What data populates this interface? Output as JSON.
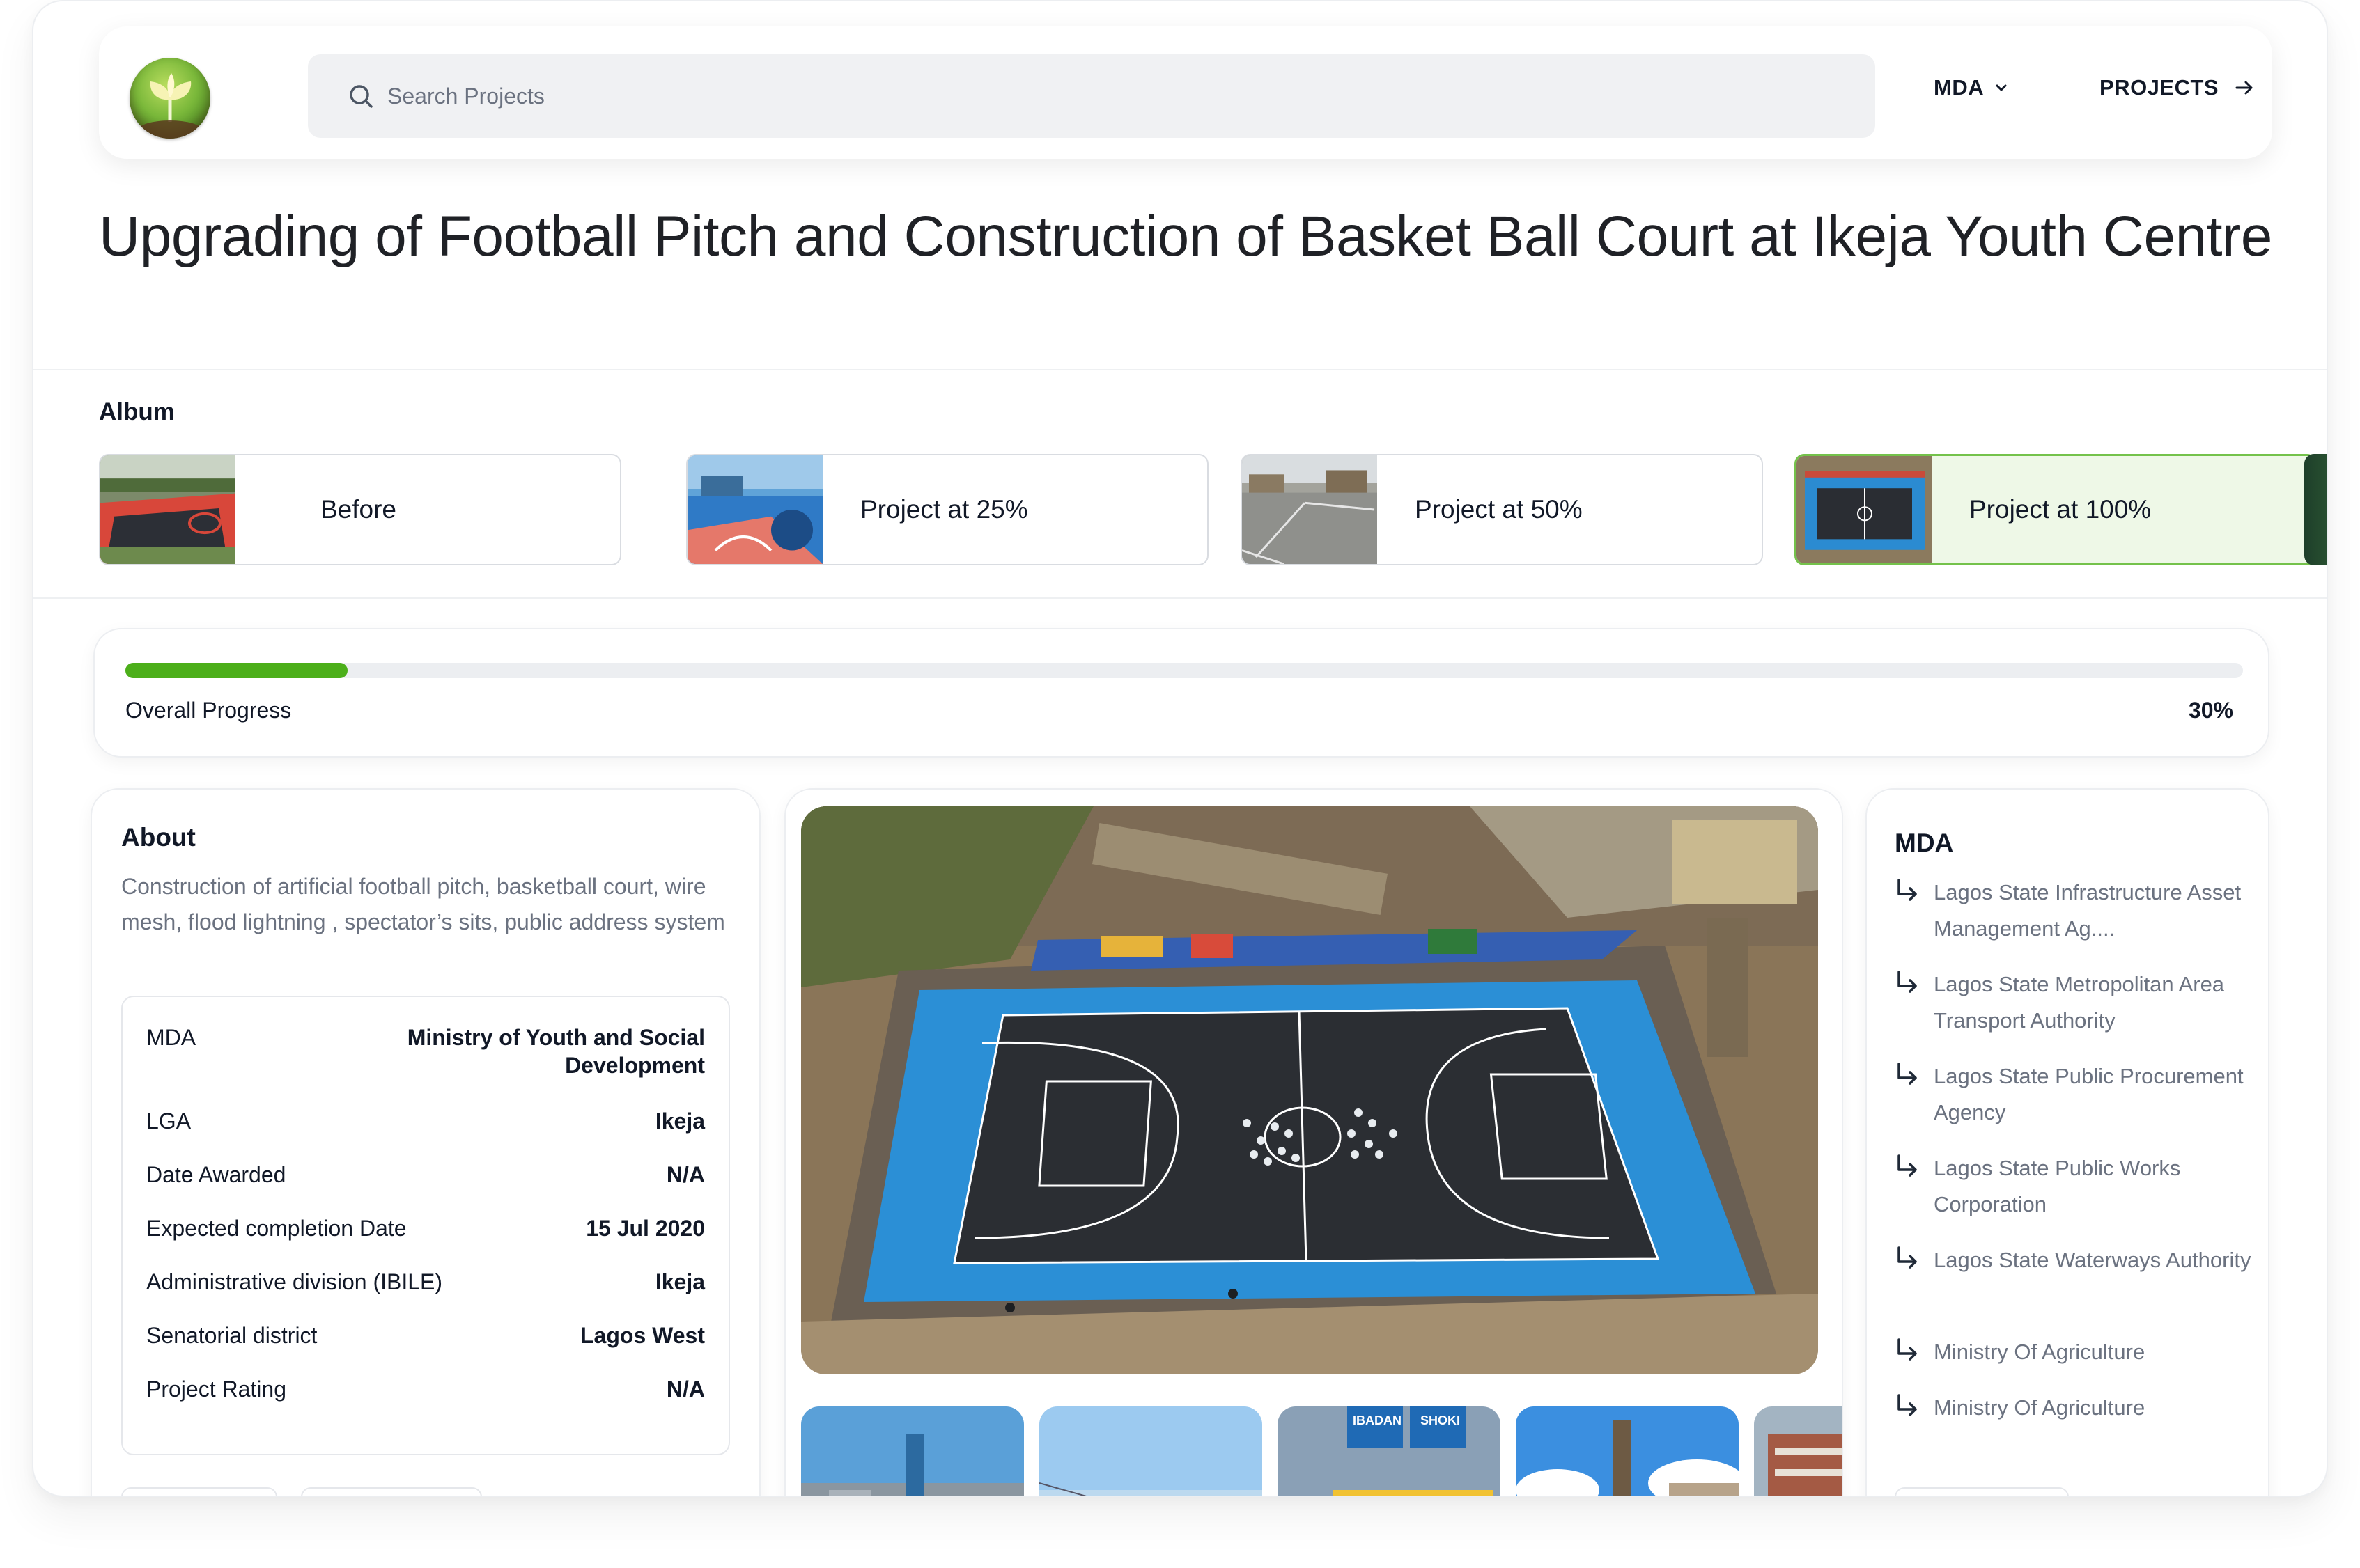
{
  "header": {
    "search_placeholder": "Search Projects",
    "nav_mda": "MDA",
    "nav_projects": "PROJECTS"
  },
  "project": {
    "title": "Upgrading of Football Pitch and Construction of  Basket Ball Court at Ikeja Youth Centre"
  },
  "album": {
    "label": "Album",
    "items": [
      {
        "label": "Before",
        "active": false
      },
      {
        "label": "Project at 25%",
        "active": false
      },
      {
        "label": "Project at 50%",
        "active": false
      },
      {
        "label": "Project at 100%",
        "active": true
      }
    ]
  },
  "progress": {
    "label": "Overall Progress",
    "value_text": "30%",
    "value": 0.105
  },
  "about": {
    "title": "About",
    "description": "Construction of artificial football pitch, basketball court, wire mesh, flood lightning , spectator’s sits, public address system",
    "details": [
      {
        "key": "MDA",
        "value": "Ministry of Youth and Social Development"
      },
      {
        "key": "LGA",
        "value": "Ikeja"
      },
      {
        "key": "Date Awarded",
        "value": "N/A"
      },
      {
        "key": "Expected completion Date",
        "value": "15 Jul 2020"
      },
      {
        "key": "Administrative division (IBILE)",
        "value": "Ikeja"
      },
      {
        "key": "Senatorial district",
        "value": "Lagos West"
      },
      {
        "key": "Project Rating",
        "value": "N/A"
      }
    ]
  },
  "gallery": {
    "sign_text_1": "IBADAN",
    "sign_text_2": "SHOKI"
  },
  "mda_list": {
    "title": "MDA",
    "items": [
      "Lagos State Infrastructure Asset Management Ag....",
      "Lagos State Metropolitan Area Transport Authority",
      "Lagos State Public Procurement Agency",
      "Lagos State Public Works Corporation",
      "Lagos State Waterways Authority",
      "Ministry Of Agriculture",
      "Ministry Of Agriculture"
    ]
  },
  "colors": {
    "accent_green": "#4caf1a",
    "active_card_bg": "#eef8e7",
    "active_card_border": "#74c24b",
    "muted_text": "#6b7280"
  }
}
